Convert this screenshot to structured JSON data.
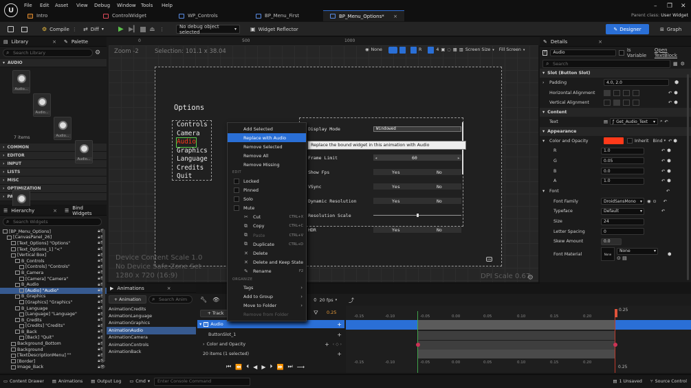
{
  "menu": [
    "File",
    "Edit",
    "Asset",
    "View",
    "Debug",
    "Window",
    "Tools",
    "Help"
  ],
  "tabs": [
    {
      "label": "Intro",
      "icon": "orange"
    },
    {
      "label": "ControlWidget",
      "icon": "red"
    },
    {
      "label": "WP_Controls",
      "icon": "blue"
    },
    {
      "label": "BP_Menu_First",
      "icon": "blue"
    },
    {
      "label": "BP_Menu_Options*",
      "icon": "blue",
      "close": "×"
    }
  ],
  "parent_class": {
    "label": "Parent class:",
    "value": "User Widget"
  },
  "toolbar": {
    "compile": "Compile",
    "diff": "Diff",
    "debug_object": "No debug object selected",
    "widget_reflector": "Widget Reflector",
    "designer": "Designer",
    "graph": "Graph"
  },
  "library": {
    "tab_library": "Library",
    "tab_palette": "Palette",
    "search_placeholder": "Search Library",
    "section_audio": "AUDIO",
    "tile_label": "Audio...",
    "items_count": "7 items",
    "sections": [
      "COMMON",
      "EDITOR",
      "INPUT",
      "LISTS",
      "MISC",
      "OPTIMIZATION",
      "PANEL"
    ]
  },
  "hierarchy": {
    "tab": "Hierarchy",
    "bind_tab": "Bind Widgets",
    "search_placeholder": "Search Widgets",
    "rows": [
      {
        "t": "[BP_Menu_Options]",
        "d": 0
      },
      {
        "t": "[CanvasPanel_26]",
        "d": 1
      },
      {
        "t": "[Text_Options] \"Options\"",
        "d": 2
      },
      {
        "t": "[Text_Options_1] \"<\"",
        "d": 2
      },
      {
        "t": "[Vertical Box]",
        "d": 2
      },
      {
        "t": "B_Controls",
        "d": 3
      },
      {
        "t": "[Controls] \"Controls\"",
        "d": 4
      },
      {
        "t": "B_Camera",
        "d": 3
      },
      {
        "t": "[Camera] \"Camera\"",
        "d": 4
      },
      {
        "t": "B_Audio",
        "d": 3
      },
      {
        "t": "[Audio] \"Audio\"",
        "d": 4,
        "sel": true
      },
      {
        "t": "B_Graphics",
        "d": 3
      },
      {
        "t": "[Graphics] \"Graphics\"",
        "d": 4
      },
      {
        "t": "B_Language",
        "d": 3
      },
      {
        "t": "[Language] \"Language\"",
        "d": 4
      },
      {
        "t": "B_Credits",
        "d": 3
      },
      {
        "t": "[Credits] \"Credits\"",
        "d": 4
      },
      {
        "t": "B_Back",
        "d": 3
      },
      {
        "t": "[Back] \"Quit\"",
        "d": 4
      },
      {
        "t": "Background_Bottom",
        "d": 2
      },
      {
        "t": "Background",
        "d": 2
      },
      {
        "t": "[TextDescriptionMenu] \"\"",
        "d": 2
      },
      {
        "t": "[Border]",
        "d": 2
      },
      {
        "t": "Image_Back",
        "d": 2
      }
    ]
  },
  "viewport": {
    "zoom": "Zoom -2",
    "selection": "Selection: 101.1 x 38.04",
    "ruler": [
      "0",
      "500",
      "1000"
    ],
    "none": "None",
    "r": "R",
    "screen_size": "Screen Size",
    "fill_screen": "Fill Screen",
    "device_scale": "Device Content Scale 1.0",
    "safe_zone": "No Device Safe Zone Set",
    "resolution": "1280 x 720 (16:9)",
    "dpi": "DPI Scale 0.67"
  },
  "canvas": {
    "title": "Options",
    "menu": [
      "Controls",
      "Camera",
      "Audio",
      "Graphics",
      "Language",
      "Credits",
      "Quit"
    ],
    "options": [
      {
        "label": "Display Mode",
        "value": "Windowed"
      },
      {
        "label": "",
        "value": ""
      },
      {
        "label": "Frame Limit",
        "value": "60"
      },
      {
        "label": "Show Fps",
        "yes": "Yes",
        "no": "No"
      },
      {
        "label": "VSync",
        "yes": "Yes",
        "no": "No"
      },
      {
        "label": "Dynamic Resolution",
        "yes": "Yes",
        "no": "No"
      },
      {
        "label": "Resolution Scale"
      },
      {
        "label": "HDR",
        "yes": "Yes",
        "no": "No"
      }
    ],
    "tooltip": "Replace the bound widget in this animation with Audio"
  },
  "context_menu": {
    "top": [
      {
        "label": "Add Selected"
      },
      {
        "label": "Replace with Audio",
        "hl": true
      },
      {
        "label": "Remove Selected"
      },
      {
        "label": "Remove All"
      },
      {
        "label": "Remove Missing"
      }
    ],
    "edit_header": "EDIT",
    "checks": [
      "Locked",
      "Pinned",
      "Solo",
      "Mute"
    ],
    "edit": [
      {
        "label": "Cut",
        "sc": "CTRL+X",
        "ic": "✂"
      },
      {
        "label": "Copy",
        "sc": "CTRL+C",
        "ic": "⧉"
      },
      {
        "label": "Paste",
        "sc": "CTRL+V",
        "ic": "⧉",
        "dim": true
      },
      {
        "label": "Duplicate",
        "sc": "CTRL+D",
        "ic": "⧉"
      },
      {
        "label": "Delete",
        "ic": "✕"
      },
      {
        "label": "Delete and Keep State",
        "ic": "✕"
      },
      {
        "label": "Rename",
        "sc": "F2",
        "ic": "✎"
      }
    ],
    "organize_header": "ORGANIZE",
    "organize": [
      {
        "label": "Tags",
        "arr": "›"
      },
      {
        "label": "Add to Group",
        "arr": "›"
      },
      {
        "label": "Move to Folder",
        "arr": "›"
      },
      {
        "label": "Remove from Folder",
        "dim": true
      }
    ]
  },
  "details": {
    "tab": "Details",
    "name": "Audio",
    "is_variable": "Is Variable",
    "open": "Open TextBlock",
    "search_placeholder": "Search",
    "slot_section": "Slot (Button Slot)",
    "padding_label": "Padding",
    "padding_value": "4.0, 2.0",
    "halign": "Horizontal Alignment",
    "valign": "Vertical Alignment",
    "content_section": "Content",
    "text_label": "Text",
    "text_value": "Get_Audio_Text",
    "appearance_section": "Appearance",
    "color_label": "Color and Opacity",
    "inherit": "Inherit",
    "bind": "Bind",
    "channels": [
      {
        "k": "R",
        "v": "1.0"
      },
      {
        "k": "G",
        "v": "0.05"
      },
      {
        "k": "B",
        "v": "0.0"
      },
      {
        "k": "A",
        "v": "1.0"
      }
    ],
    "font_section": "Font",
    "font_family_label": "Font Family",
    "font_family": "DroidSansMono",
    "typeface_label": "Typeface",
    "typeface": "Default",
    "size_label": "Size",
    "size": "24",
    "letter_spacing_label": "Letter Spacing",
    "letter_spacing": "0",
    "skew_label": "Skew Amount",
    "skew": "0.0",
    "font_material_label": "Font Material",
    "font_material": "None",
    "font_material_thumb": "None",
    "accent": "#ff3a1a"
  },
  "animations": {
    "tab": "Animations",
    "add": "+ Animation",
    "search_placeholder": "Search Anim",
    "list": [
      "AnimationCredits",
      "AnimationLanguage",
      "AnimationGraphics",
      "AnimationAudio",
      "AnimationCamera",
      "AnimationControls",
      "AnimationBack"
    ],
    "selected": "AnimationAudio"
  },
  "sequencer": {
    "track": "Track",
    "fps": "20 fps",
    "time": "0.25",
    "audio_track": "Audio",
    "sub_tracks": [
      "ButtonSlot_1",
      "Color and Opacity"
    ],
    "items_status": "20 items (1 selected)",
    "ruler": [
      "-0.15",
      "-0.10",
      "-0.05",
      "0.00",
      "0.05",
      "0.10",
      "0.15",
      "0.20"
    ],
    "playhead": "0.25"
  },
  "statusbar": {
    "content_drawer": "Content Drawer",
    "animations": "Animations",
    "output_log": "Output Log",
    "cmd": "Cmd",
    "console_placeholder": "Enter Console Command",
    "unsaved": "1 Unsaved",
    "source_control": "Source Control"
  }
}
